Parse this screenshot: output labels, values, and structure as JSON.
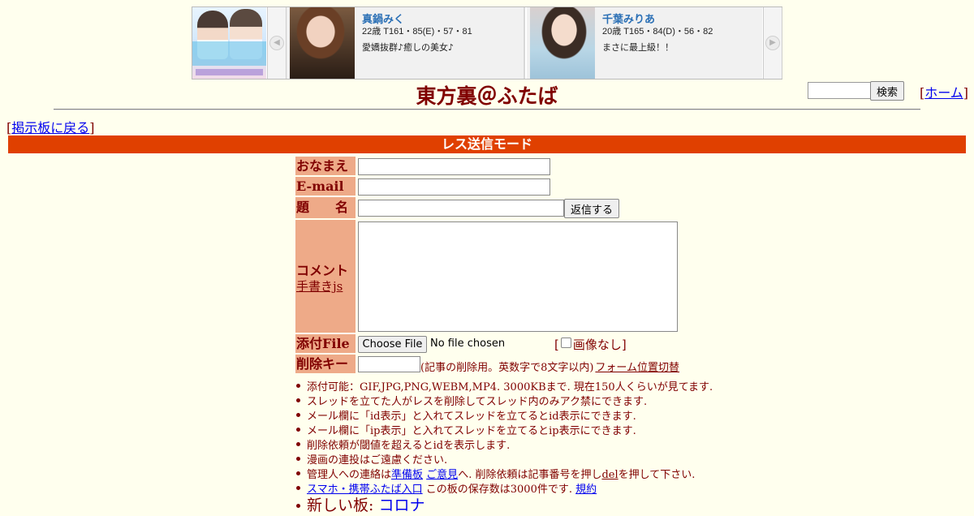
{
  "ads": {
    "cards": [
      {
        "name": "真鍋みく",
        "stats": "22歳 T161・85(E)・57・81",
        "desc": "愛嬌抜群♪癒しの美女♪"
      },
      {
        "name": "千葉みりあ",
        "stats": "20歳 T165・84(D)・56・82",
        "desc": "まさに最上級！！"
      }
    ]
  },
  "header": {
    "title": "東方裏＠ふたば",
    "search_button": "検索",
    "search_value": "",
    "home_open": "[",
    "home_link": "ホーム",
    "home_close": "]"
  },
  "nav": {
    "back_open": "[",
    "back_link": "掲示板に戻る",
    "back_close": "]"
  },
  "mode_bar": "レス送信モード",
  "form": {
    "labels": {
      "name": "おなまえ",
      "email": "E-mail",
      "subject_a": "題",
      "subject_b": "名",
      "comment": "コメント",
      "handwriting": "手書きjs",
      "file": "添付File",
      "delete_key": "削除キー"
    },
    "values": {
      "name": "",
      "email": "",
      "subject": "",
      "comment": "",
      "delete_key": ""
    },
    "submit_button": "返信する",
    "file_button": "Choose File",
    "file_status": "No file chosen",
    "no_image_open": "[",
    "no_image_label": "画像なし",
    "no_image_close": "]",
    "delete_note": "(記事の削除用。英数字で8文字以内)",
    "form_toggle": "フォーム位置切替"
  },
  "notes": {
    "n1": "添付可能：GIF,JPG,PNG,WEBM,MP4. 3000KBまで. 現在150人くらいが見てます.",
    "n2": "スレッドを立てた人がレスを削除してスレッド内のみアク禁にできます.",
    "n3": "メール欄に「id表示」と入れてスレッドを立てるとid表示にできます.",
    "n4": "メール欄に「ip表示」と入れてスレッドを立てるとip表示にできます.",
    "n5": "削除依頼が閾値を超えるとidを表示します.",
    "n6": "漫画の連投はご遠慮ください.",
    "n7_a": "管理人への連絡は",
    "n7_link1": "準備板",
    "n7_link2": "ご意見",
    "n7_b": "へ. 削除依頼は記事番号を押し",
    "n7_link3": "del",
    "n7_c": "を押して下さい.",
    "n8_link1": "スマホ・携帯ふたば入口",
    "n8_a": "この板の保存数は3000件です.",
    "n8_link2": "規約",
    "n9_a": "新しい板: ",
    "n9_link": "コロナ"
  }
}
